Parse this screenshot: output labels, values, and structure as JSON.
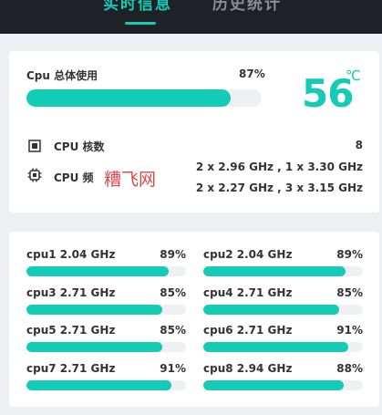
{
  "tabs": [
    {
      "label": "实时信息",
      "active": true
    },
    {
      "label": "历史统计",
      "active": false
    }
  ],
  "overview": {
    "total_label": "Cpu 总体使用",
    "total_percent": "87%",
    "total_fraction": 0.87,
    "temperature": "56",
    "temperature_unit": "℃",
    "cores_label": "CPU 核数",
    "cores_value": "8",
    "freq_label": "CPU 频",
    "freq_line1": "2 x 2.96 GHz , 1 x 3.30 GHz",
    "freq_line2": "2 x 2.27 GHz , 3 x 3.15 GHz",
    "watermark": "糟飞网"
  },
  "cores": [
    {
      "name": "cpu1 2.04 GHz",
      "percent": "89%",
      "fraction": 0.89
    },
    {
      "name": "cpu2 2.04 GHz",
      "percent": "89%",
      "fraction": 0.89
    },
    {
      "name": "cpu3 2.71 GHz",
      "percent": "85%",
      "fraction": 0.85
    },
    {
      "name": "cpu4 2.71 GHz",
      "percent": "85%",
      "fraction": 0.85
    },
    {
      "name": "cpu5 2.71 GHz",
      "percent": "85%",
      "fraction": 0.85
    },
    {
      "name": "cpu6 2.71 GHz",
      "percent": "91%",
      "fraction": 0.91
    },
    {
      "name": "cpu7 2.71 GHz",
      "percent": "91%",
      "fraction": 0.91
    },
    {
      "name": "cpu8 2.94 GHz",
      "percent": "88%",
      "fraction": 0.88
    }
  ],
  "colors": {
    "accent": "#14cbb8",
    "topbar": "#1e2226",
    "track": "#eef0f3",
    "background": "#eeeff2"
  },
  "icons": {
    "cores": "chip-icon",
    "frequency": "processor-icon"
  }
}
